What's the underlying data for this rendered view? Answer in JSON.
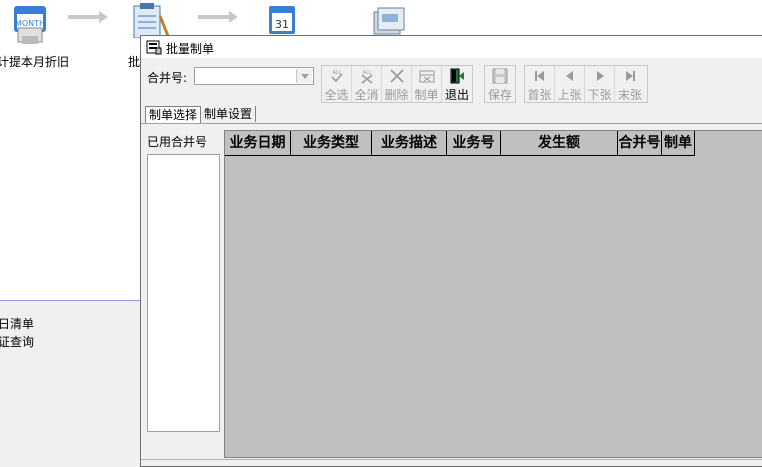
{
  "workspace": {
    "flow_labels": [
      "计提本月折旧",
      "批"
    ],
    "side_links": [
      "日清单",
      "证查询"
    ]
  },
  "dialog": {
    "title": "批量制单",
    "merge_label": "合并号:",
    "merge_value": "",
    "toolbar": {
      "select_all": "全选",
      "deselect_all": "全消",
      "delete": "删除",
      "make_voucher": "制单",
      "exit": "退出",
      "save": "保存",
      "first": "首张",
      "prev": "上张",
      "next": "下张",
      "last": "末张"
    },
    "tabs": [
      "制单选择",
      "制单设置"
    ],
    "used_merge_label": "已用合并号",
    "grid": {
      "columns": [
        "业务日期",
        "业务类型",
        "业务描述",
        "业务号",
        "发生额",
        "合并号",
        "制单"
      ]
    }
  },
  "colors": {
    "grid_background": "#c0c0c0",
    "window_background": "#f0f0f0",
    "exit_icon": "#1a7a3a"
  }
}
